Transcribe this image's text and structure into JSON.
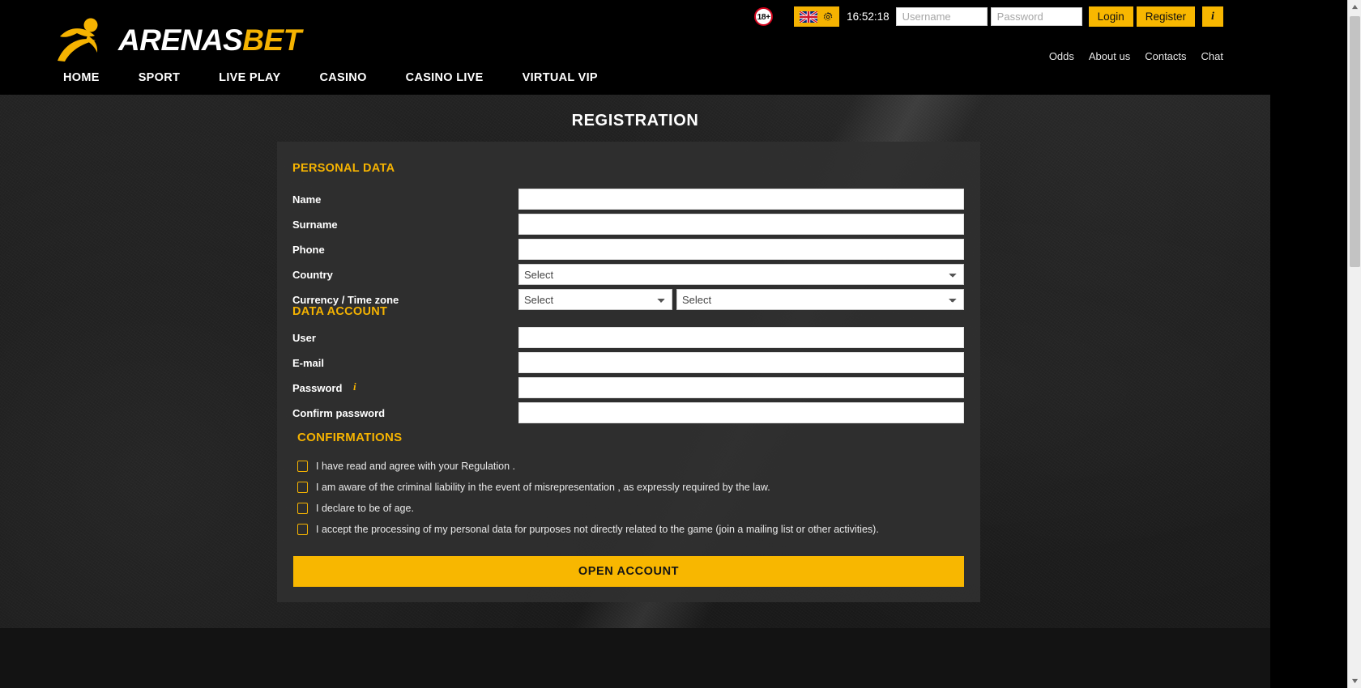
{
  "brand": {
    "name_part_1": "ARENAS",
    "name_part_2": "BET",
    "logo_icon": "running-athlete-icon"
  },
  "header": {
    "age_badge": "18+",
    "language_icon": "uk-flag-icon",
    "settings_icon": "gear-icon",
    "clock": "16:52:18",
    "username_placeholder": "Username",
    "username_value": "",
    "password_placeholder": "Password",
    "password_value": "",
    "login_label": "Login",
    "register_label": "Register",
    "info_label": "i",
    "main_nav": [
      {
        "label": "HOME"
      },
      {
        "label": "SPORT"
      },
      {
        "label": "LIVE PLAY"
      },
      {
        "label": "CASINO"
      },
      {
        "label": "CASINO LIVE"
      },
      {
        "label": "VIRTUAL VIP"
      }
    ],
    "sub_nav": [
      {
        "label": "Odds"
      },
      {
        "label": "About us"
      },
      {
        "label": "Contacts"
      },
      {
        "label": "Chat"
      }
    ]
  },
  "page": {
    "title": "REGISTRATION"
  },
  "form": {
    "sections": {
      "personal_data": "PERSONAL DATA",
      "data_account": "DATA ACCOUNT",
      "confirmations": "CONFIRMATIONS"
    },
    "fields": {
      "name": {
        "label": "Name",
        "value": ""
      },
      "surname": {
        "label": "Surname",
        "value": ""
      },
      "phone": {
        "label": "Phone",
        "value": ""
      },
      "country": {
        "label": "Country",
        "selected": "Select"
      },
      "currency_timezone": {
        "label": "Currency / Time zone",
        "currency_selected": "Select",
        "timezone_selected": "Select"
      },
      "user": {
        "label": "User",
        "value": ""
      },
      "email": {
        "label": "E-mail",
        "value": ""
      },
      "password": {
        "label": "Password",
        "value": "",
        "info_icon_label": "i"
      },
      "confirm_password": {
        "label": "Confirm password",
        "value": ""
      }
    },
    "confirmations": [
      {
        "label": "I have read and agree with your Regulation .",
        "checked": false
      },
      {
        "label": "I am aware of the criminal liability in the event of misrepresentation , as expressly required by the law.",
        "checked": false
      },
      {
        "label": "I declare to be of age.",
        "checked": false
      },
      {
        "label": "I accept the processing of my personal data for purposes not directly related to the game (join a mailing list or other activities).",
        "checked": false
      }
    ],
    "submit_label": "OPEN ACCOUNT"
  },
  "colors": {
    "brand_yellow": "#f5b301",
    "button_yellow": "#f8b700",
    "header_black": "#000000",
    "panel_gray": "#2f2f2f",
    "text_white": "#ffffff"
  }
}
